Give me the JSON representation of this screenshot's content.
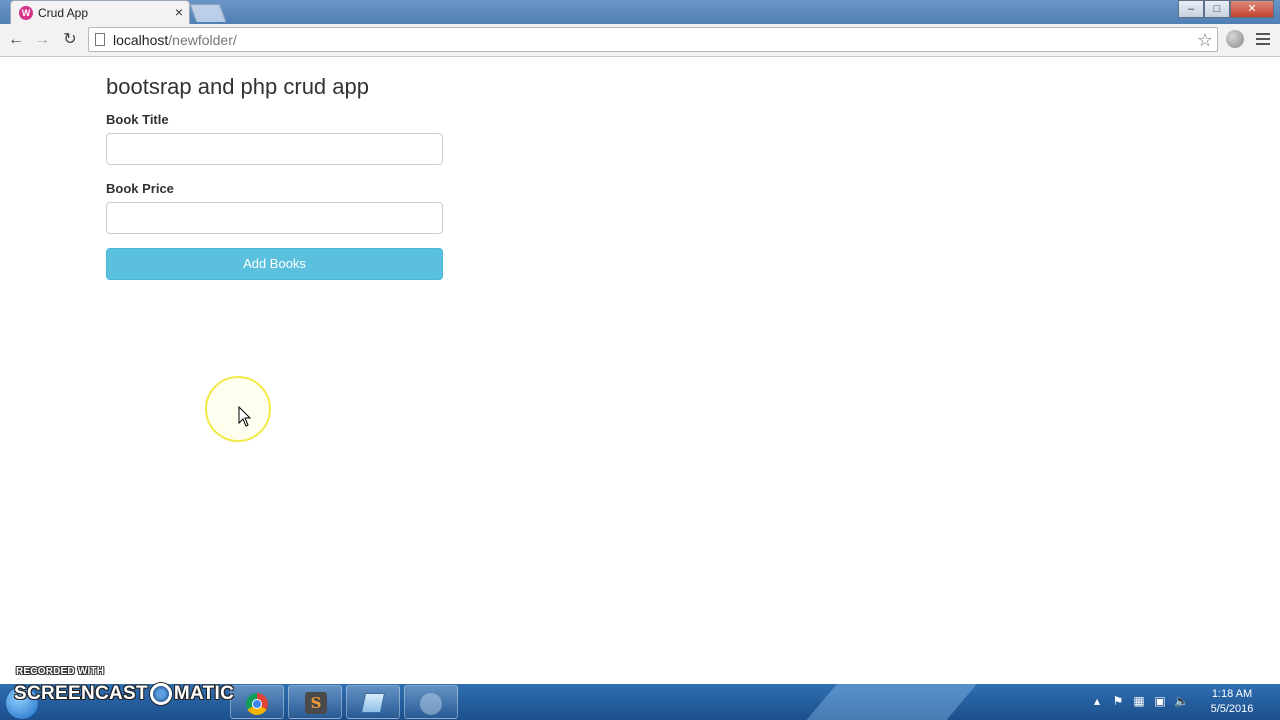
{
  "browser": {
    "tab_title": "Crud App",
    "tab_close": "×",
    "favicon_letter": "W",
    "url_host": "localhost",
    "url_path": "/newfolder/",
    "window_controls": {
      "minimize": "–",
      "maximize": "□",
      "close": "✕"
    }
  },
  "page": {
    "title": "bootsrap and php crud app",
    "book_title_label": "Book Title",
    "book_title_value": "",
    "book_price_label": "Book Price",
    "book_price_value": "",
    "add_button_label": "Add Books"
  },
  "watermark": {
    "recorded_with": "RECORDED WITH",
    "brand_left": "SCREENCAST",
    "brand_right": "MATIC"
  },
  "taskbar": {
    "apps": [
      "internet-explorer",
      "explorer",
      "media-player",
      "chrome",
      "sublime-text",
      "notepad",
      "unknown"
    ],
    "time": "1:18 AM",
    "date": "5/5/2016"
  },
  "colors": {
    "button_bg": "#5bc0de",
    "cursor_ring": "#f1e84a"
  }
}
